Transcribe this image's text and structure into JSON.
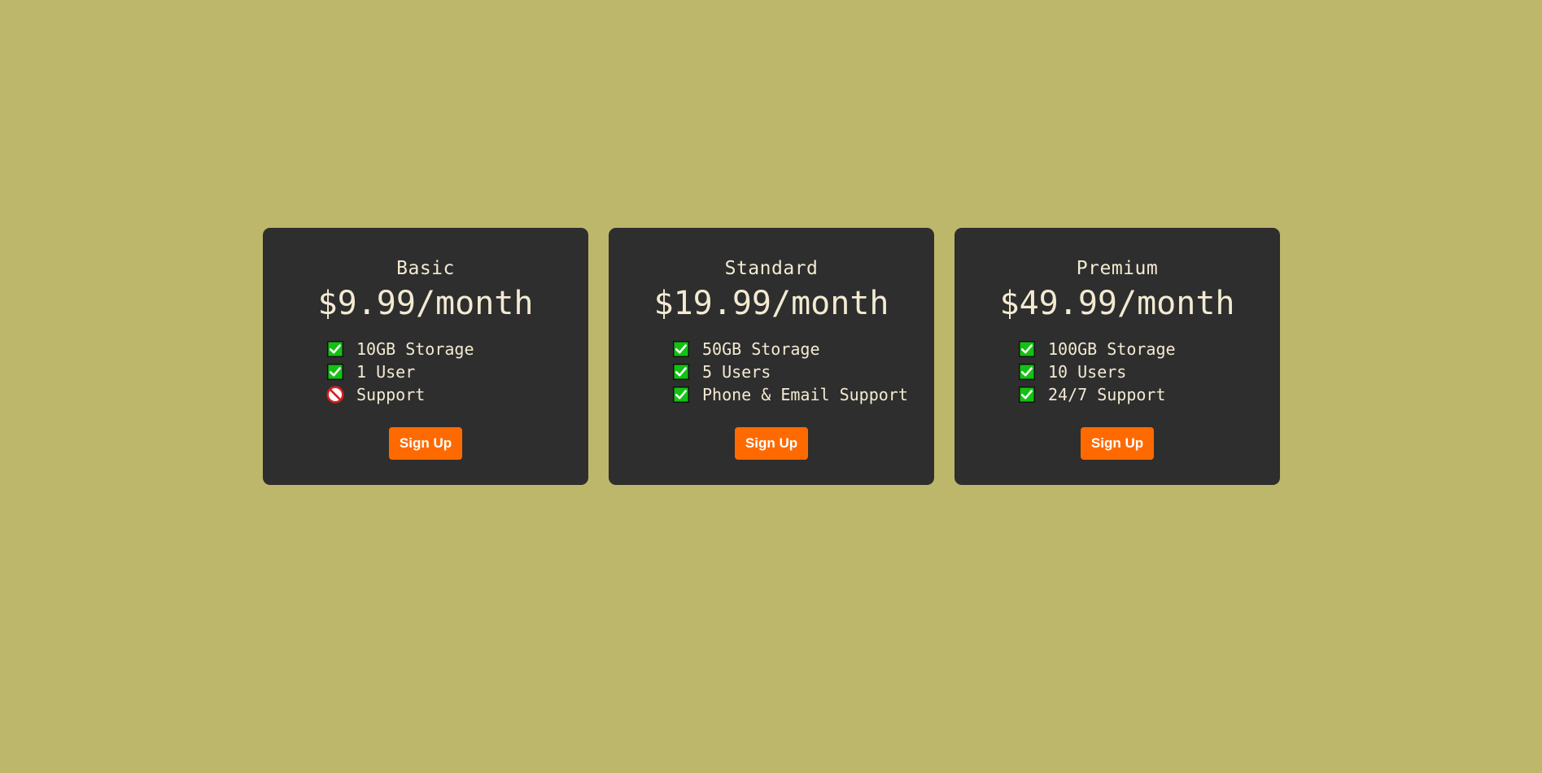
{
  "colors": {
    "page_background": "#bdb76b",
    "card_background": "#2e2e2e",
    "card_text": "#f3ead2",
    "button_background": "#ff6a00",
    "button_text": "#ffffff",
    "check_green": "#12c212",
    "no_red": "#d42020"
  },
  "plans": [
    {
      "name": "Basic",
      "price": "$9.99/month",
      "features": [
        {
          "label": "10GB Storage",
          "icon": "check-icon",
          "included": true
        },
        {
          "label": "1 User",
          "icon": "check-icon",
          "included": true
        },
        {
          "label": "Support",
          "icon": "no-entry-icon",
          "included": false
        }
      ],
      "button_label": "Sign Up"
    },
    {
      "name": "Standard",
      "price": "$19.99/month",
      "features": [
        {
          "label": "50GB Storage",
          "icon": "check-icon",
          "included": true
        },
        {
          "label": "5 Users",
          "icon": "check-icon",
          "included": true
        },
        {
          "label": "Phone & Email Support",
          "icon": "check-icon",
          "included": true
        }
      ],
      "button_label": "Sign Up"
    },
    {
      "name": "Premium",
      "price": "$49.99/month",
      "features": [
        {
          "label": "100GB Storage",
          "icon": "check-icon",
          "included": true
        },
        {
          "label": "10 Users",
          "icon": "check-icon",
          "included": true
        },
        {
          "label": "24/7 Support",
          "icon": "check-icon",
          "included": true
        }
      ],
      "button_label": "Sign Up"
    }
  ]
}
